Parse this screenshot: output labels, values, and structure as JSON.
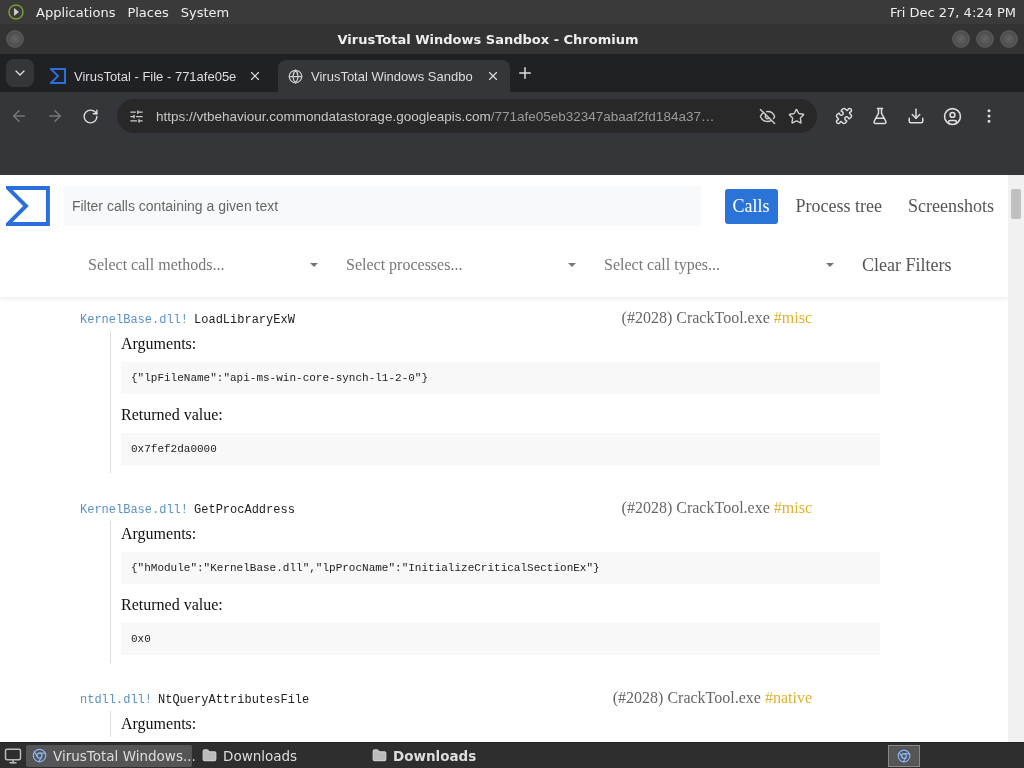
{
  "desktop_panel": {
    "menus": [
      "Applications",
      "Places",
      "System"
    ],
    "clock": "Fri Dec 27,  4:24 PM"
  },
  "window": {
    "title": "VirusTotal Windows Sandbox - Chromium"
  },
  "tabs": [
    {
      "label": "VirusTotal - File - 771afe05e",
      "selected": false,
      "kind": "sigma"
    },
    {
      "label": "VirusTotal Windows Sandbo",
      "selected": true,
      "kind": "globe"
    }
  ],
  "address_bar": {
    "host": "https://vtbehaviour.commondatastorage.googleapis.com",
    "path": "/771afe05eb32347abaaf2fd184a37…"
  },
  "page": {
    "filter": {
      "placeholder": "Filter calls containing a given text"
    },
    "nav": [
      {
        "label": "Calls",
        "selected": true
      },
      {
        "label": "Process tree",
        "selected": false
      },
      {
        "label": "Screenshots",
        "selected": false
      }
    ],
    "selects": [
      {
        "placeholder": "Select call methods..."
      },
      {
        "placeholder": "Select processes..."
      },
      {
        "placeholder": "Select call types..."
      }
    ],
    "clear_filters": "Clear Filters",
    "calls": [
      {
        "module": "KernelBase.dll!",
        "function": "LoadLibraryExW",
        "process": "(#2028) CrackTool.exe",
        "tag": "#misc",
        "arguments_label": "Arguments:",
        "arguments": "{\"lpFileName\":\"api-ms-win-core-synch-l1-2-0\"}",
        "returned_label": "Returned value:",
        "returned": "0x7fef2da0000"
      },
      {
        "module": "KernelBase.dll!",
        "function": "GetProcAddress",
        "process": "(#2028) CrackTool.exe",
        "tag": "#misc",
        "arguments_label": "Arguments:",
        "arguments": "{\"hModule\":\"KernelBase.dll\",\"lpProcName\":\"InitializeCriticalSectionEx\"}",
        "returned_label": "Returned value:",
        "returned": "0x0"
      },
      {
        "module": "ntdll.dll!",
        "function": "NtQueryAttributesFile",
        "process": "(#2028) CrackTool.exe",
        "tag": "#native",
        "arguments_label": "Arguments:"
      }
    ]
  },
  "taskbar": {
    "items": [
      {
        "label": "VirusTotal Windows...",
        "kind": "browser",
        "selected": true,
        "urgent": false
      },
      {
        "label": "Downloads",
        "kind": "folder",
        "selected": false,
        "urgent": false
      },
      {
        "label": "Downloads",
        "kind": "folder",
        "selected": false,
        "urgent": true
      }
    ]
  }
}
